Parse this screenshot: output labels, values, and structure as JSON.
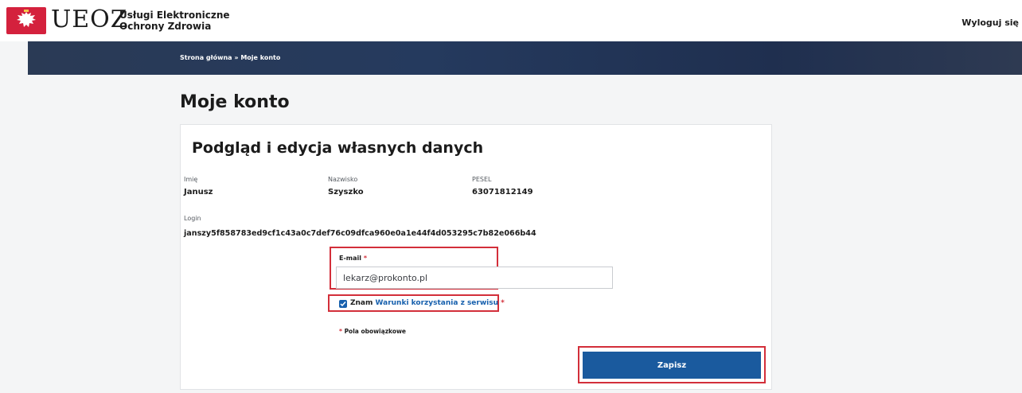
{
  "header": {
    "logo_text": "UEOZ",
    "logo_subtitle_line1": "Usługi Elektroniczne",
    "logo_subtitle_line2": "Ochrony Zdrowia",
    "logout_label": "Wyloguj się"
  },
  "breadcrumb": "Strona główna » Moje konto",
  "page_title": "Moje konto",
  "card": {
    "title": "Podgląd i edycja własnych danych",
    "fields": {
      "first_name": {
        "label": "Imię",
        "value": "Janusz"
      },
      "last_name": {
        "label": "Nazwisko",
        "value": "Szyszko"
      },
      "pesel": {
        "label": "PESEL",
        "value": "63071812149"
      },
      "login": {
        "label": "Login",
        "value": "janszy5f858783ed9cf1c43a0c7def76c09dfca960e0a1e44f4d053295c7b82e066b44"
      }
    },
    "email": {
      "label": "E-mail",
      "required_mark": "*",
      "value": "lekarz@prokonto.pl"
    },
    "terms": {
      "prefix": "Znam",
      "link": "Warunki korzystania z serwisu",
      "required_mark": "*",
      "checked": true
    },
    "required_note_mark": "*",
    "required_note": "Pola obowiązkowe",
    "save_label": "Zapisz"
  },
  "colors": {
    "accent": "#1a5a9e",
    "highlight": "#d32f3a",
    "brand_red": "#d4213d",
    "nav_bar": "#253a5e"
  }
}
